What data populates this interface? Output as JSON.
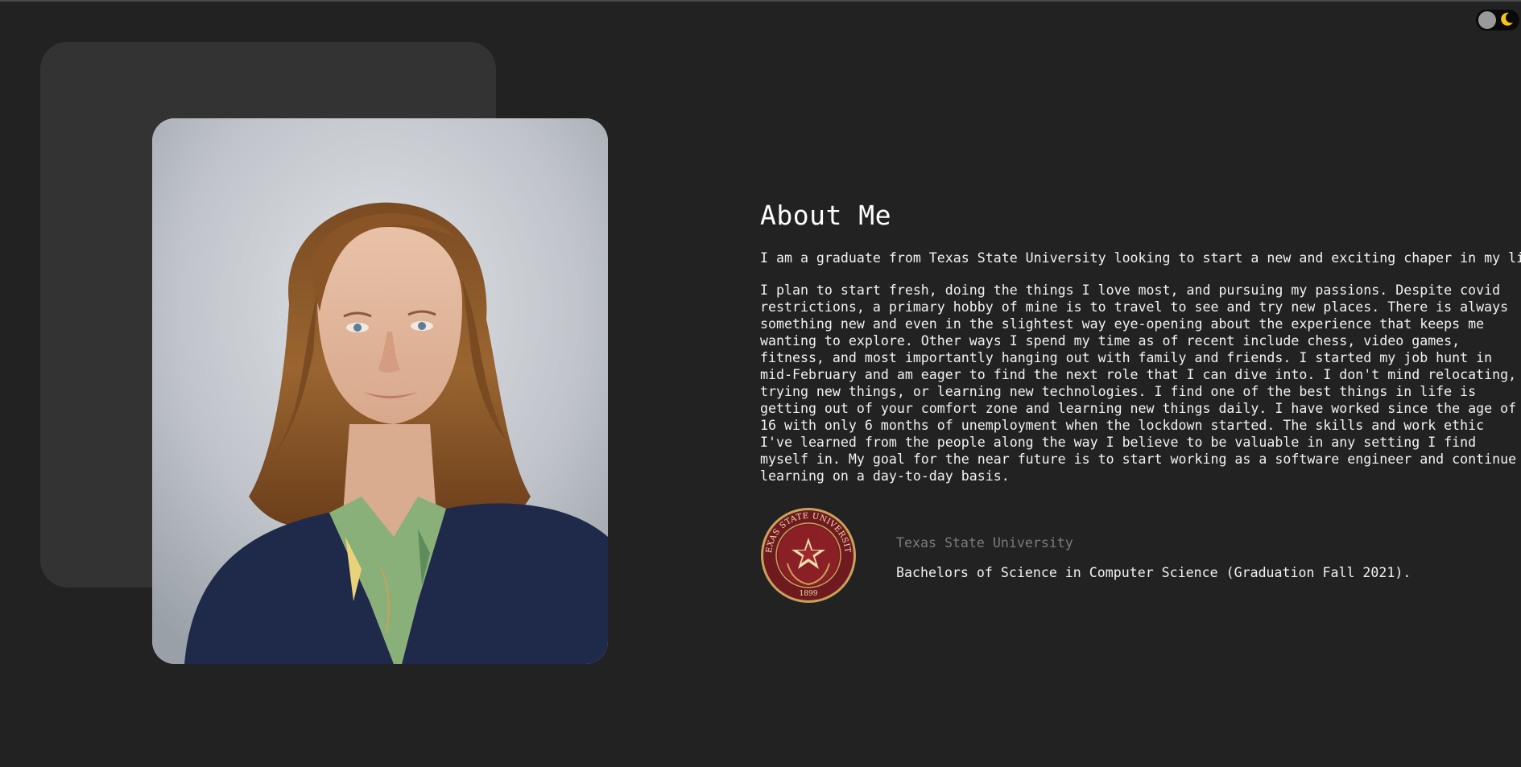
{
  "theme_toggle": {
    "knob_icon": "circle-knob",
    "moon_icon": "moon-icon",
    "moon_color": "#f5c518"
  },
  "portrait": {
    "description_icon": "portrait-photo"
  },
  "about": {
    "heading": "About Me",
    "intro": "I am a graduate from Texas State University looking to start a new and exciting chaper in my life.",
    "body": "I plan to start fresh, doing the things I love most, and pursuing my passions. Despite covid restrictions, a primary hobby of mine is to travel to see and try new places. There is always something new and even in the slightest way eye-opening about the experience that keeps me wanting to explore. Other ways I spend my time as of recent include chess, video games, fitness, and most importantly hanging out with family and friends. I started my job hunt in mid-February and am eager to find the next role that I can dive into. I don't mind relocating, trying new things, or learning new technologies. I find one of the best things in life is getting out of your comfort zone and learning new things daily. I have worked since the age of 16 with only 6 months of unemployment when the lockdown started. The skills and work ethic I've learned from the people along the way I believe to be valuable in any setting I find myself in. My goal for the near future is to start working as a software engineer and continue learning on a day-to-day basis."
  },
  "education": {
    "seal_text": "TEXAS STATE UNIVERSITY",
    "seal_year": "1899",
    "school": "Texas State University",
    "degree": "Bachelors of Science in Computer Science (Graduation Fall 2021).",
    "seal_color": "#6e1a1f",
    "seal_gold": "#c8a25a"
  }
}
